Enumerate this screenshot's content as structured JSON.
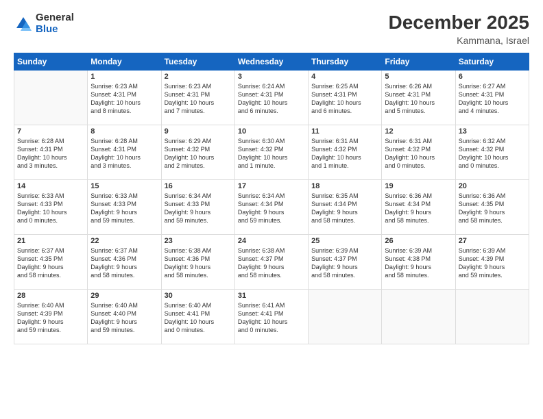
{
  "logo": {
    "general": "General",
    "blue": "Blue"
  },
  "title": "December 2025",
  "location": "Kammana, Israel",
  "weekdays": [
    "Sunday",
    "Monday",
    "Tuesday",
    "Wednesday",
    "Thursday",
    "Friday",
    "Saturday"
  ],
  "weeks": [
    [
      {
        "day": "",
        "info": ""
      },
      {
        "day": "1",
        "info": "Sunrise: 6:23 AM\nSunset: 4:31 PM\nDaylight: 10 hours\nand 8 minutes."
      },
      {
        "day": "2",
        "info": "Sunrise: 6:23 AM\nSunset: 4:31 PM\nDaylight: 10 hours\nand 7 minutes."
      },
      {
        "day": "3",
        "info": "Sunrise: 6:24 AM\nSunset: 4:31 PM\nDaylight: 10 hours\nand 6 minutes."
      },
      {
        "day": "4",
        "info": "Sunrise: 6:25 AM\nSunset: 4:31 PM\nDaylight: 10 hours\nand 6 minutes."
      },
      {
        "day": "5",
        "info": "Sunrise: 6:26 AM\nSunset: 4:31 PM\nDaylight: 10 hours\nand 5 minutes."
      },
      {
        "day": "6",
        "info": "Sunrise: 6:27 AM\nSunset: 4:31 PM\nDaylight: 10 hours\nand 4 minutes."
      }
    ],
    [
      {
        "day": "7",
        "info": "Sunrise: 6:28 AM\nSunset: 4:31 PM\nDaylight: 10 hours\nand 3 minutes."
      },
      {
        "day": "8",
        "info": "Sunrise: 6:28 AM\nSunset: 4:31 PM\nDaylight: 10 hours\nand 3 minutes."
      },
      {
        "day": "9",
        "info": "Sunrise: 6:29 AM\nSunset: 4:32 PM\nDaylight: 10 hours\nand 2 minutes."
      },
      {
        "day": "10",
        "info": "Sunrise: 6:30 AM\nSunset: 4:32 PM\nDaylight: 10 hours\nand 1 minute."
      },
      {
        "day": "11",
        "info": "Sunrise: 6:31 AM\nSunset: 4:32 PM\nDaylight: 10 hours\nand 1 minute."
      },
      {
        "day": "12",
        "info": "Sunrise: 6:31 AM\nSunset: 4:32 PM\nDaylight: 10 hours\nand 0 minutes."
      },
      {
        "day": "13",
        "info": "Sunrise: 6:32 AM\nSunset: 4:32 PM\nDaylight: 10 hours\nand 0 minutes."
      }
    ],
    [
      {
        "day": "14",
        "info": "Sunrise: 6:33 AM\nSunset: 4:33 PM\nDaylight: 10 hours\nand 0 minutes."
      },
      {
        "day": "15",
        "info": "Sunrise: 6:33 AM\nSunset: 4:33 PM\nDaylight: 9 hours\nand 59 minutes."
      },
      {
        "day": "16",
        "info": "Sunrise: 6:34 AM\nSunset: 4:33 PM\nDaylight: 9 hours\nand 59 minutes."
      },
      {
        "day": "17",
        "info": "Sunrise: 6:34 AM\nSunset: 4:34 PM\nDaylight: 9 hours\nand 59 minutes."
      },
      {
        "day": "18",
        "info": "Sunrise: 6:35 AM\nSunset: 4:34 PM\nDaylight: 9 hours\nand 58 minutes."
      },
      {
        "day": "19",
        "info": "Sunrise: 6:36 AM\nSunset: 4:34 PM\nDaylight: 9 hours\nand 58 minutes."
      },
      {
        "day": "20",
        "info": "Sunrise: 6:36 AM\nSunset: 4:35 PM\nDaylight: 9 hours\nand 58 minutes."
      }
    ],
    [
      {
        "day": "21",
        "info": "Sunrise: 6:37 AM\nSunset: 4:35 PM\nDaylight: 9 hours\nand 58 minutes."
      },
      {
        "day": "22",
        "info": "Sunrise: 6:37 AM\nSunset: 4:36 PM\nDaylight: 9 hours\nand 58 minutes."
      },
      {
        "day": "23",
        "info": "Sunrise: 6:38 AM\nSunset: 4:36 PM\nDaylight: 9 hours\nand 58 minutes."
      },
      {
        "day": "24",
        "info": "Sunrise: 6:38 AM\nSunset: 4:37 PM\nDaylight: 9 hours\nand 58 minutes."
      },
      {
        "day": "25",
        "info": "Sunrise: 6:39 AM\nSunset: 4:37 PM\nDaylight: 9 hours\nand 58 minutes."
      },
      {
        "day": "26",
        "info": "Sunrise: 6:39 AM\nSunset: 4:38 PM\nDaylight: 9 hours\nand 58 minutes."
      },
      {
        "day": "27",
        "info": "Sunrise: 6:39 AM\nSunset: 4:39 PM\nDaylight: 9 hours\nand 59 minutes."
      }
    ],
    [
      {
        "day": "28",
        "info": "Sunrise: 6:40 AM\nSunset: 4:39 PM\nDaylight: 9 hours\nand 59 minutes."
      },
      {
        "day": "29",
        "info": "Sunrise: 6:40 AM\nSunset: 4:40 PM\nDaylight: 9 hours\nand 59 minutes."
      },
      {
        "day": "30",
        "info": "Sunrise: 6:40 AM\nSunset: 4:41 PM\nDaylight: 10 hours\nand 0 minutes."
      },
      {
        "day": "31",
        "info": "Sunrise: 6:41 AM\nSunset: 4:41 PM\nDaylight: 10 hours\nand 0 minutes."
      },
      {
        "day": "",
        "info": ""
      },
      {
        "day": "",
        "info": ""
      },
      {
        "day": "",
        "info": ""
      }
    ]
  ]
}
